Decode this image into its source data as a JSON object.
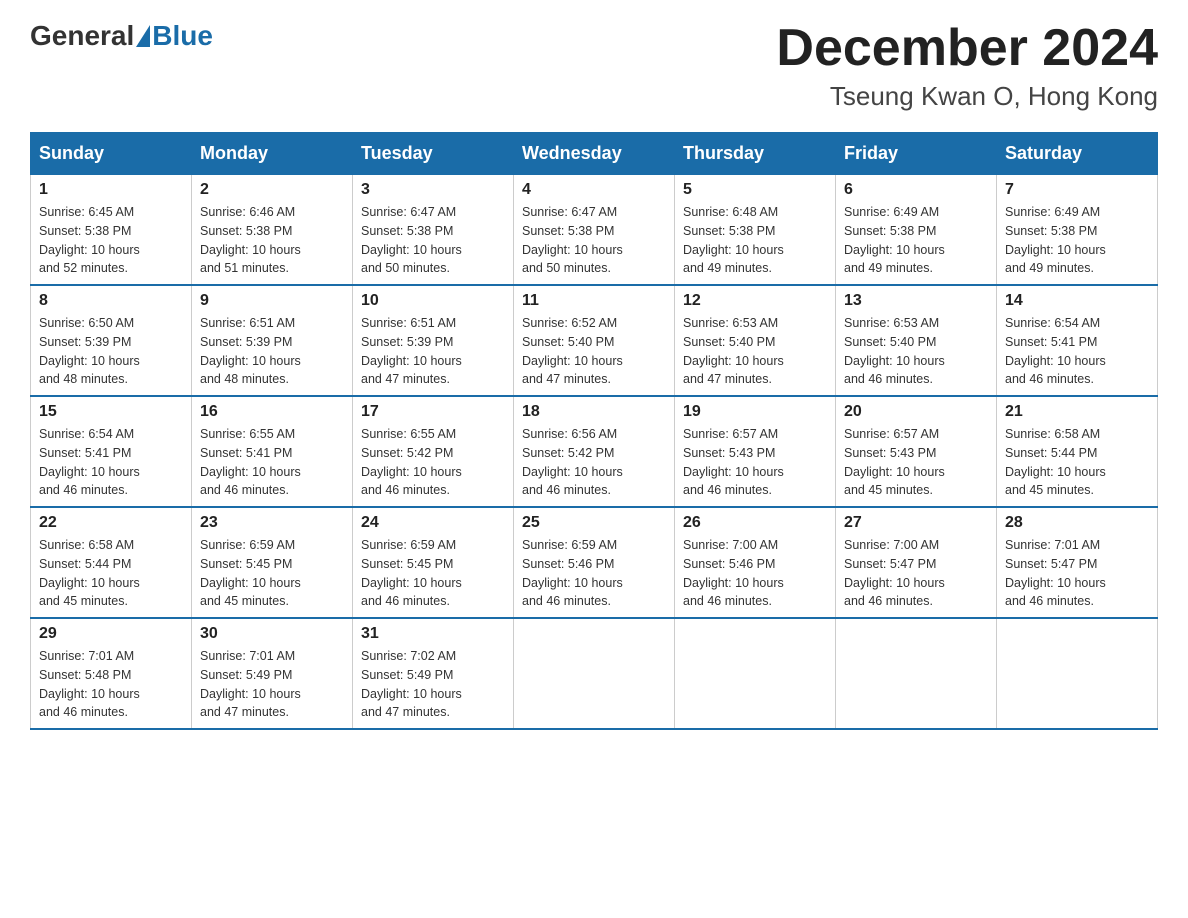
{
  "header": {
    "logo_general": "General",
    "logo_blue": "Blue",
    "month": "December 2024",
    "location": "Tseung Kwan O, Hong Kong"
  },
  "weekdays": [
    "Sunday",
    "Monday",
    "Tuesday",
    "Wednesday",
    "Thursday",
    "Friday",
    "Saturday"
  ],
  "weeks": [
    [
      {
        "day": "1",
        "sunrise": "6:45 AM",
        "sunset": "5:38 PM",
        "daylight": "10 hours and 52 minutes."
      },
      {
        "day": "2",
        "sunrise": "6:46 AM",
        "sunset": "5:38 PM",
        "daylight": "10 hours and 51 minutes."
      },
      {
        "day": "3",
        "sunrise": "6:47 AM",
        "sunset": "5:38 PM",
        "daylight": "10 hours and 50 minutes."
      },
      {
        "day": "4",
        "sunrise": "6:47 AM",
        "sunset": "5:38 PM",
        "daylight": "10 hours and 50 minutes."
      },
      {
        "day": "5",
        "sunrise": "6:48 AM",
        "sunset": "5:38 PM",
        "daylight": "10 hours and 49 minutes."
      },
      {
        "day": "6",
        "sunrise": "6:49 AM",
        "sunset": "5:38 PM",
        "daylight": "10 hours and 49 minutes."
      },
      {
        "day": "7",
        "sunrise": "6:49 AM",
        "sunset": "5:38 PM",
        "daylight": "10 hours and 49 minutes."
      }
    ],
    [
      {
        "day": "8",
        "sunrise": "6:50 AM",
        "sunset": "5:39 PM",
        "daylight": "10 hours and 48 minutes."
      },
      {
        "day": "9",
        "sunrise": "6:51 AM",
        "sunset": "5:39 PM",
        "daylight": "10 hours and 48 minutes."
      },
      {
        "day": "10",
        "sunrise": "6:51 AM",
        "sunset": "5:39 PM",
        "daylight": "10 hours and 47 minutes."
      },
      {
        "day": "11",
        "sunrise": "6:52 AM",
        "sunset": "5:40 PM",
        "daylight": "10 hours and 47 minutes."
      },
      {
        "day": "12",
        "sunrise": "6:53 AM",
        "sunset": "5:40 PM",
        "daylight": "10 hours and 47 minutes."
      },
      {
        "day": "13",
        "sunrise": "6:53 AM",
        "sunset": "5:40 PM",
        "daylight": "10 hours and 46 minutes."
      },
      {
        "day": "14",
        "sunrise": "6:54 AM",
        "sunset": "5:41 PM",
        "daylight": "10 hours and 46 minutes."
      }
    ],
    [
      {
        "day": "15",
        "sunrise": "6:54 AM",
        "sunset": "5:41 PM",
        "daylight": "10 hours and 46 minutes."
      },
      {
        "day": "16",
        "sunrise": "6:55 AM",
        "sunset": "5:41 PM",
        "daylight": "10 hours and 46 minutes."
      },
      {
        "day": "17",
        "sunrise": "6:55 AM",
        "sunset": "5:42 PM",
        "daylight": "10 hours and 46 minutes."
      },
      {
        "day": "18",
        "sunrise": "6:56 AM",
        "sunset": "5:42 PM",
        "daylight": "10 hours and 46 minutes."
      },
      {
        "day": "19",
        "sunrise": "6:57 AM",
        "sunset": "5:43 PM",
        "daylight": "10 hours and 46 minutes."
      },
      {
        "day": "20",
        "sunrise": "6:57 AM",
        "sunset": "5:43 PM",
        "daylight": "10 hours and 45 minutes."
      },
      {
        "day": "21",
        "sunrise": "6:58 AM",
        "sunset": "5:44 PM",
        "daylight": "10 hours and 45 minutes."
      }
    ],
    [
      {
        "day": "22",
        "sunrise": "6:58 AM",
        "sunset": "5:44 PM",
        "daylight": "10 hours and 45 minutes."
      },
      {
        "day": "23",
        "sunrise": "6:59 AM",
        "sunset": "5:45 PM",
        "daylight": "10 hours and 45 minutes."
      },
      {
        "day": "24",
        "sunrise": "6:59 AM",
        "sunset": "5:45 PM",
        "daylight": "10 hours and 46 minutes."
      },
      {
        "day": "25",
        "sunrise": "6:59 AM",
        "sunset": "5:46 PM",
        "daylight": "10 hours and 46 minutes."
      },
      {
        "day": "26",
        "sunrise": "7:00 AM",
        "sunset": "5:46 PM",
        "daylight": "10 hours and 46 minutes."
      },
      {
        "day": "27",
        "sunrise": "7:00 AM",
        "sunset": "5:47 PM",
        "daylight": "10 hours and 46 minutes."
      },
      {
        "day": "28",
        "sunrise": "7:01 AM",
        "sunset": "5:47 PM",
        "daylight": "10 hours and 46 minutes."
      }
    ],
    [
      {
        "day": "29",
        "sunrise": "7:01 AM",
        "sunset": "5:48 PM",
        "daylight": "10 hours and 46 minutes."
      },
      {
        "day": "30",
        "sunrise": "7:01 AM",
        "sunset": "5:49 PM",
        "daylight": "10 hours and 47 minutes."
      },
      {
        "day": "31",
        "sunrise": "7:02 AM",
        "sunset": "5:49 PM",
        "daylight": "10 hours and 47 minutes."
      },
      null,
      null,
      null,
      null
    ]
  ],
  "labels": {
    "sunrise": "Sunrise:",
    "sunset": "Sunset:",
    "daylight": "Daylight:"
  }
}
